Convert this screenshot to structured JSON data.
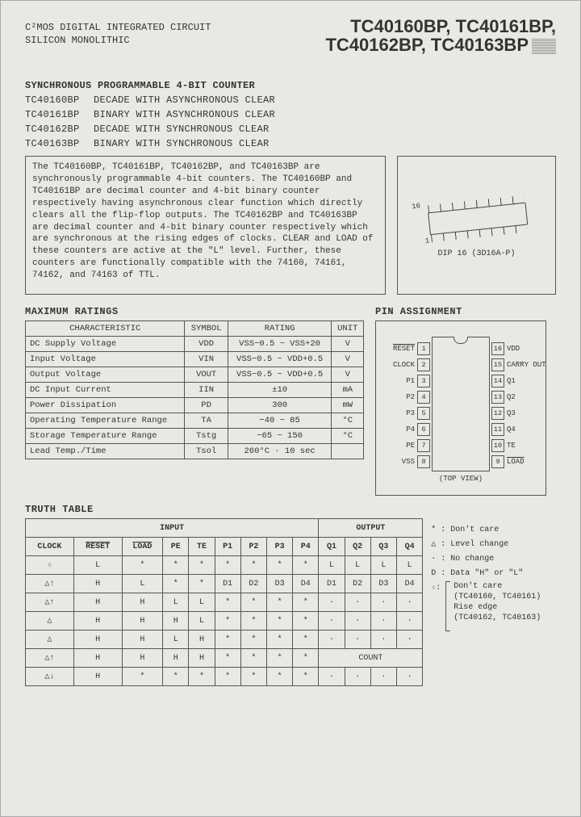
{
  "header": {
    "left_line1": "C²MOS DIGITAL INTEGRATED CIRCUIT",
    "left_line2": "SILICON MONOLITHIC",
    "right_line1": "TC40160BP, TC40161BP,",
    "right_line2": "TC40162BP, TC40163BP"
  },
  "title_block": {
    "main": "SYNCHRONOUS PROGRAMMABLE 4-BIT COUNTER",
    "rows": [
      {
        "pn": "TC40160BP",
        "desc": "DECADE WITH ASYNCHRONOUS CLEAR"
      },
      {
        "pn": "TC40161BP",
        "desc": "BINARY WITH ASYNCHRONOUS CLEAR"
      },
      {
        "pn": "TC40162BP",
        "desc": "DECADE WITH SYNCHRONOUS CLEAR"
      },
      {
        "pn": "TC40163BP",
        "desc": "BINARY WITH SYNCHRONOUS CLEAR"
      }
    ]
  },
  "description": "The TC40160BP, TC40161BP, TC40162BP, and TC40163BP are synchronously programmable 4-bit counters. The TC40160BP and TC40161BP are decimal counter and 4-bit binary counter respectively having asynchronous clear function which directly clears all the flip-flop outputs.  The TC40162BP and TC40163BP are decimal counter and 4-bit binary counter respectively which are synchronous at the rising edges of clocks. CLEAR and LOAD of these counters are active at the \"L\" level.  Further, these counters are functionally compatible with the 74160, 74161, 74162, and 74163 of TTL.",
  "package": {
    "pin16": "16",
    "pin1": "1",
    "caption": "DIP 16 (3D16A-P)"
  },
  "max_ratings": {
    "header": "MAXIMUM RATINGS",
    "cols": [
      "CHARACTERISTIC",
      "SYMBOL",
      "RATING",
      "UNIT"
    ],
    "rows": [
      [
        "DC Supply Voltage",
        "VDD",
        "VSS−0.5 ~ VSS+20",
        "V"
      ],
      [
        "Input Voltage",
        "VIN",
        "VSS−0.5 ~ VDD+0.5",
        "V"
      ],
      [
        "Output Voltage",
        "VOUT",
        "VSS−0.5 ~ VDD+0.5",
        "V"
      ],
      [
        "DC Input Current",
        "IIN",
        "±10",
        "mA"
      ],
      [
        "Power Dissipation",
        "PD",
        "300",
        "mW"
      ],
      [
        "Operating Temperature Range",
        "TA",
        "−40 ~ 85",
        "°C"
      ],
      [
        "Storage Temperature Range",
        "Tstg",
        "−65 ~ 150",
        "°C"
      ],
      [
        "Lead Temp./Time",
        "Tsol",
        "260°C · 10 sec",
        ""
      ]
    ]
  },
  "pin_assign": {
    "header": "PIN ASSIGNMENT",
    "caption": "(TOP VIEW)",
    "left": [
      {
        "n": "1",
        "lab": "RESET",
        "ol": true
      },
      {
        "n": "2",
        "lab": "CLOCK"
      },
      {
        "n": "3",
        "lab": "P1"
      },
      {
        "n": "4",
        "lab": "P2"
      },
      {
        "n": "5",
        "lab": "P3"
      },
      {
        "n": "6",
        "lab": "P4"
      },
      {
        "n": "7",
        "lab": "PE"
      },
      {
        "n": "8",
        "lab": "VSS"
      }
    ],
    "right": [
      {
        "n": "16",
        "lab": "VDD"
      },
      {
        "n": "15",
        "lab": "CARRY OUT"
      },
      {
        "n": "14",
        "lab": "Q1"
      },
      {
        "n": "13",
        "lab": "Q2"
      },
      {
        "n": "12",
        "lab": "Q3"
      },
      {
        "n": "11",
        "lab": "Q4"
      },
      {
        "n": "10",
        "lab": "TE"
      },
      {
        "n": "9",
        "lab": "LOAD",
        "ol": true
      }
    ]
  },
  "truth_table": {
    "header": "TRUTH TABLE",
    "group_input": "INPUT",
    "group_output": "OUTPUT",
    "cols": [
      "CLOCK",
      "RESET",
      "LOAD",
      "PE",
      "TE",
      "P1",
      "P2",
      "P3",
      "P4",
      "Q1",
      "Q2",
      "Q3",
      "Q4"
    ],
    "rows": [
      [
        "☆",
        "L",
        "*",
        "*",
        "*",
        "*",
        "*",
        "*",
        "*",
        "L",
        "L",
        "L",
        "L"
      ],
      [
        "△↑",
        "H",
        "L",
        "*",
        "*",
        "D1",
        "D2",
        "D3",
        "D4",
        "D1",
        "D2",
        "D3",
        "D4"
      ],
      [
        "△↑",
        "H",
        "H",
        "L",
        "L",
        "*",
        "*",
        "*",
        "*",
        "·",
        "·",
        "·",
        "·"
      ],
      [
        "△",
        "H",
        "H",
        "H",
        "L",
        "*",
        "*",
        "*",
        "*",
        "·",
        "·",
        "·",
        "·"
      ],
      [
        "△",
        "H",
        "H",
        "L",
        "H",
        "*",
        "*",
        "*",
        "*",
        "·",
        "·",
        "·",
        "·"
      ],
      [
        "△↑",
        "H",
        "H",
        "H",
        "H",
        "*",
        "*",
        "*",
        "*",
        "COUNT",
        "",
        "",
        ""
      ],
      [
        "△↓",
        "H",
        "*",
        "*",
        "*",
        "*",
        "*",
        "*",
        "*",
        "·",
        "·",
        "·",
        "·"
      ]
    ]
  },
  "legend": {
    "star": "* : Don't care",
    "tri": "△ : Level change",
    "dot": "· : No change",
    "d": "D : Data \"H\" or \"L\"",
    "sstar_a": "Don't care",
    "sstar_a2": "(TC40160, TC40161)",
    "sstar_b": "Rise edge",
    "sstar_b2": "(TC40162, TC40163)",
    "sstar_sym": "☆:"
  }
}
